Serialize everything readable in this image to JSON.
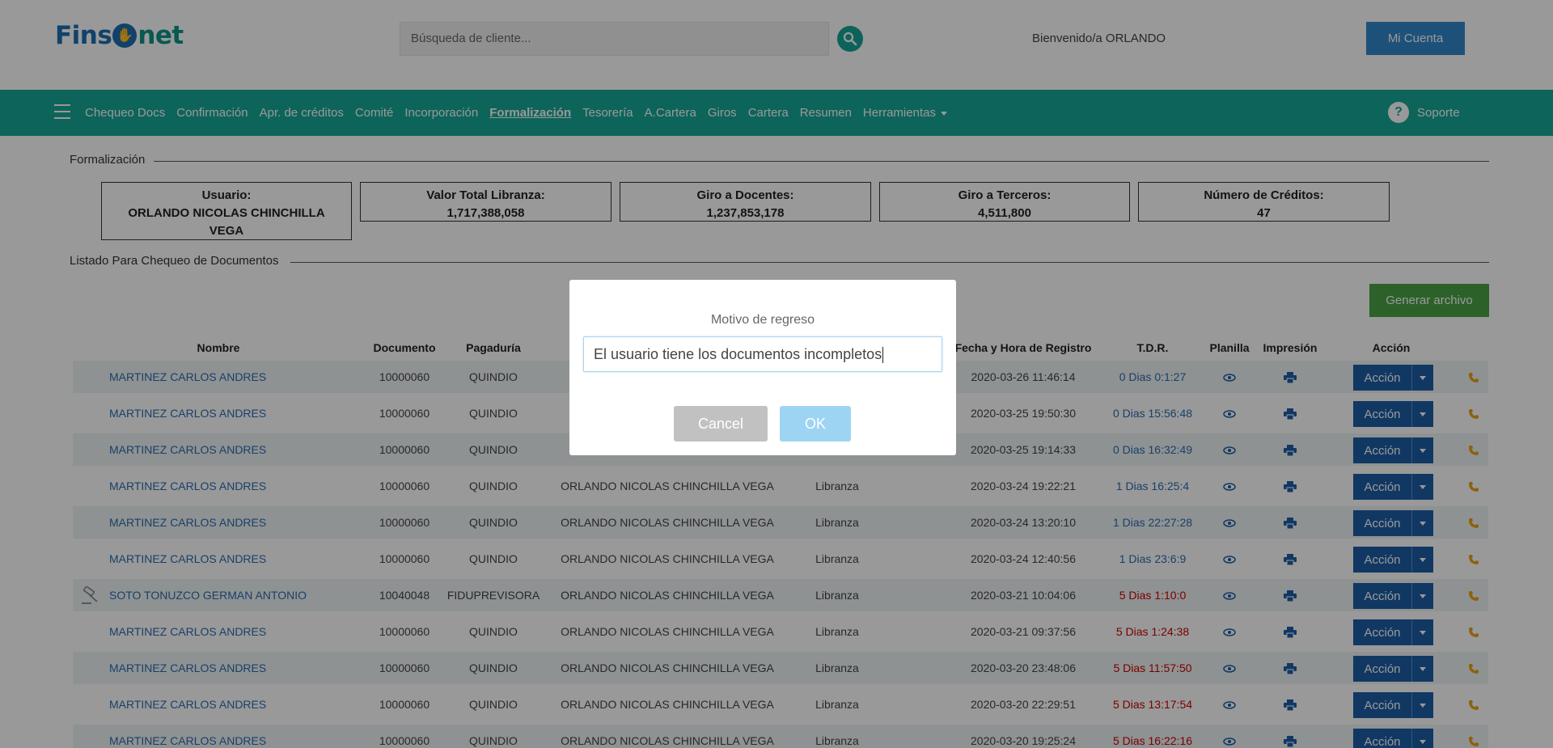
{
  "header": {
    "logo_left": "Fins",
    "logo_right": "net",
    "search_placeholder": "Búsqueda de cliente...",
    "welcome": "Bienvenido/a ORLANDO",
    "account_button": "Mi Cuenta"
  },
  "nav": {
    "items": [
      "Chequeo Docs",
      "Confirmación",
      "Apr. de créditos",
      "Comité",
      "Incorporación",
      "Formalización",
      "Tesorería",
      "A.Cartera",
      "Giros",
      "Cartera",
      "Resumen",
      "Herramientas"
    ],
    "active": "Formalización",
    "support": "Soporte"
  },
  "section1": {
    "title": "Formalización"
  },
  "stats": {
    "user_label": "Usuario:",
    "user_value": "ORLANDO NICOLAS CHINCHILLA VEGA",
    "libranza_label": "Valor Total Libranza:",
    "libranza_value": "1,717,388,058",
    "docentes_label": "Giro a Docentes:",
    "docentes_value": "1,237,853,178",
    "terceros_label": "Giro a Terceros:",
    "terceros_value": "4,511,800",
    "creditos_label": "Número de Créditos:",
    "creditos_value": "47"
  },
  "section2": {
    "title": "Listado Para Chequeo de Documentos",
    "generate_button": "Generar archivo"
  },
  "table": {
    "headers": [
      "Nombre",
      "Documento",
      "Pagaduría",
      "Fecha y Hora de Registro",
      "T.D.R.",
      "Planilla",
      "Impresión",
      "Acción"
    ],
    "action_label": "Acción",
    "rows": [
      {
        "name": "MARTINEZ CARLOS ANDRES",
        "doc": "10000060",
        "pagaduria": "QUINDIO",
        "asesor": "",
        "tipo": "",
        "fecha": "2020-03-26 11:46:14",
        "tdr": "0 Dias 0:1:27",
        "tdr_color": "blue"
      },
      {
        "name": "MARTINEZ CARLOS ANDRES",
        "doc": "10000060",
        "pagaduria": "QUINDIO",
        "asesor": "",
        "tipo": "",
        "fecha": "2020-03-25 19:50:30",
        "tdr": "0 Dias 15:56:48",
        "tdr_color": "blue"
      },
      {
        "name": "MARTINEZ CARLOS ANDRES",
        "doc": "10000060",
        "pagaduria": "QUINDIO",
        "asesor": "",
        "tipo": "",
        "fecha": "2020-03-25 19:14:33",
        "tdr": "0 Dias 16:32:49",
        "tdr_color": "blue"
      },
      {
        "name": "MARTINEZ CARLOS ANDRES",
        "doc": "10000060",
        "pagaduria": "QUINDIO",
        "asesor": "ORLANDO NICOLAS CHINCHILLA VEGA",
        "tipo": "Libranza",
        "fecha": "2020-03-24 19:22:21",
        "tdr": "1 Dias 16:25:4",
        "tdr_color": "blue"
      },
      {
        "name": "MARTINEZ CARLOS ANDRES",
        "doc": "10000060",
        "pagaduria": "QUINDIO",
        "asesor": "ORLANDO NICOLAS CHINCHILLA VEGA",
        "tipo": "Libranza",
        "fecha": "2020-03-24 13:20:10",
        "tdr": "1 Dias 22:27:28",
        "tdr_color": "blue"
      },
      {
        "name": "MARTINEZ CARLOS ANDRES",
        "doc": "10000060",
        "pagaduria": "QUINDIO",
        "asesor": "ORLANDO NICOLAS CHINCHILLA VEGA",
        "tipo": "Libranza",
        "fecha": "2020-03-24 12:40:56",
        "tdr": "1 Dias 23:6:9",
        "tdr_color": "blue"
      },
      {
        "name": "SOTO TONUZCO GERMAN ANTONIO",
        "doc": "10040048",
        "pagaduria": "FIDUPREVISORA",
        "asesor": "ORLANDO NICOLAS CHINCHILLA VEGA",
        "tipo": "Libranza",
        "fecha": "2020-03-21 10:04:06",
        "tdr": "5 Dias 1:10:0",
        "tdr_color": "red",
        "gavel": true
      },
      {
        "name": "MARTINEZ CARLOS ANDRES",
        "doc": "10000060",
        "pagaduria": "QUINDIO",
        "asesor": "ORLANDO NICOLAS CHINCHILLA VEGA",
        "tipo": "Libranza",
        "fecha": "2020-03-21 09:37:56",
        "tdr": "5 Dias 1:24:38",
        "tdr_color": "red"
      },
      {
        "name": "MARTINEZ CARLOS ANDRES",
        "doc": "10000060",
        "pagaduria": "QUINDIO",
        "asesor": "ORLANDO NICOLAS CHINCHILLA VEGA",
        "tipo": "Libranza",
        "fecha": "2020-03-20 23:48:06",
        "tdr": "5 Dias 11:57:50",
        "tdr_color": "red"
      },
      {
        "name": "MARTINEZ CARLOS ANDRES",
        "doc": "10000060",
        "pagaduria": "QUINDIO",
        "asesor": "ORLANDO NICOLAS CHINCHILLA VEGA",
        "tipo": "Libranza",
        "fecha": "2020-03-20 22:29:51",
        "tdr": "5 Dias 13:17:54",
        "tdr_color": "red"
      },
      {
        "name": "MARTINEZ CARLOS ANDRES",
        "doc": "10000060",
        "pagaduria": "QUINDIO",
        "asesor": "ORLANDO NICOLAS CHINCHILLA VEGA",
        "tipo": "Libranza",
        "fecha": "2020-03-20 19:25:24",
        "tdr": "5 Dias 16:22:16",
        "tdr_color": "red"
      }
    ]
  },
  "modal": {
    "title": "Motivo de regreso",
    "input_value": "El usuario tiene los documentos incompletos",
    "cancel": "Cancel",
    "ok": "OK"
  },
  "colors": {
    "teal": "#16a796",
    "blue": "#1d5ea6",
    "green": "#4aa447",
    "red": "#cc0000"
  }
}
